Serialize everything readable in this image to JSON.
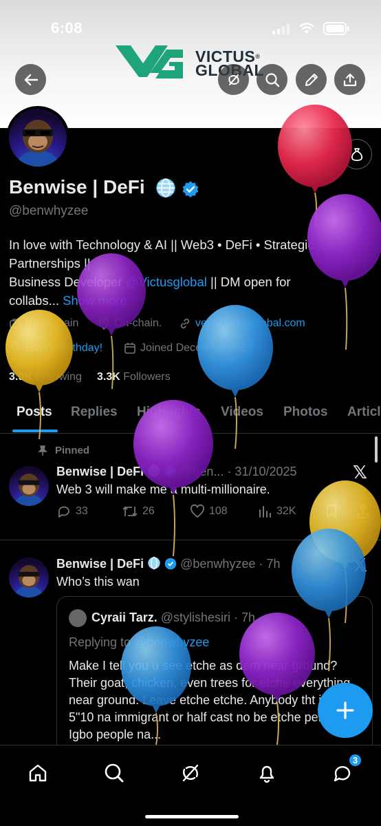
{
  "status_bar": {
    "time": "6:08"
  },
  "banner": {
    "brand_line1": "VICTUS",
    "brand_line2": "GLOBAL",
    "registered": "®"
  },
  "profile": {
    "name": "Benwise | DeFi",
    "handle": "@benwhyzee",
    "bio_part1": "In love with Technology & AI || Web3 • DeFi • Strategic Partnerships ||",
    "bio_part2": "Business Developer ",
    "bio_mention": "@Victusglobal",
    "bio_part3": " || DM open for collabs...",
    "show_more": "Show more",
    "category": "Blockchain",
    "location": "On-chain.",
    "website": "verify.victusglobal.com",
    "birthday": "Happy birthday!",
    "joined": "Joined December 2022",
    "following_count": "3.9K",
    "following_label": "Following",
    "followers_count": "3.3K",
    "followers_label": "Followers"
  },
  "tabs": [
    "Posts",
    "Replies",
    "Highlights",
    "Videos",
    "Photos",
    "Articles"
  ],
  "pinned_label": "Pinned",
  "post1": {
    "name": "Benwise | DeFi",
    "handle_date": "@ben... · 31/10/2025",
    "text": "Web 3 will make me a multi-millionaire.",
    "replies": "33",
    "reposts": "26",
    "likes": "108",
    "views": "32K"
  },
  "post2": {
    "name": "Benwise | DeFi",
    "handle_time": "@benwhyzee · 7h",
    "text": "Who’s this wan",
    "quote": {
      "name": "Cyraii Tarz.",
      "handle_time": "@stylishesiri · 7h",
      "replying_label": "Replying to ",
      "replying_handle": "@benwhyzee",
      "text": "Make I tell you u see etche as dem near ground? Their goat, chicken, even trees for etche everything near ground. Leave etche etche. Anybody tht is abv 5\"10 na immigrant or half cast no be etche person. Igbo people na..."
    }
  },
  "bottom_nav": {
    "messages_badge": "3"
  },
  "colors": {
    "accent": "#1d9bf0",
    "background": "#000000",
    "secondary_text": "#71767b",
    "brand_green": "#1fa37a"
  },
  "icons": [
    "back-arrow-icon",
    "grok-icon",
    "search-icon",
    "edit-icon",
    "share-icon",
    "money-bag-icon",
    "globe-icon",
    "verified-badge-icon",
    "briefcase-icon",
    "location-icon",
    "link-icon",
    "balloon-icon",
    "calendar-icon",
    "pin-icon",
    "x-logo-icon",
    "reply-icon",
    "repost-icon",
    "like-icon",
    "views-icon",
    "bookmark-icon",
    "home-icon",
    "explore-icon",
    "notifications-icon",
    "messages-icon",
    "plus-icon"
  ]
}
